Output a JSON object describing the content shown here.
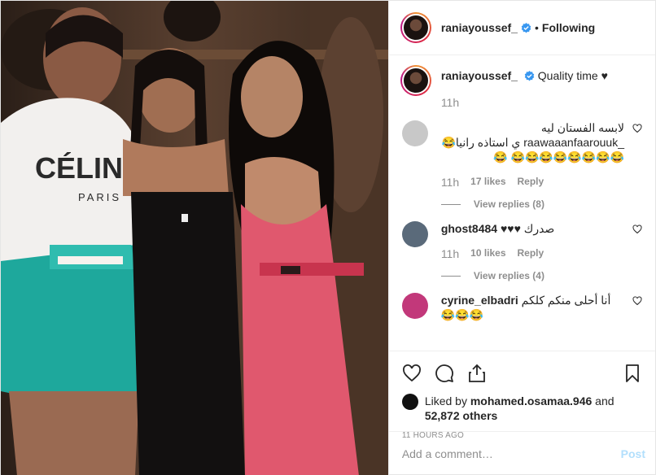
{
  "post": {
    "author": "raniayoussef_",
    "follow_state": "Following",
    "caption": "Quality time ♥",
    "caption_time": "11h",
    "photo_text": {
      "shirt_brand": "CÉLINE",
      "shirt_city": "PARIS"
    }
  },
  "comments": [
    {
      "user": "_raawaaanfaarouuk",
      "text": "لابسه الفستان ليه _raawaaanfaarouuk ي استاذه رانيا😂😂😂😂😂😂😂😂😂 😂",
      "time": "11h",
      "likes": "17 likes",
      "reply": "Reply",
      "view_replies": "View replies (8)",
      "avatar_color": "#c8c8c8"
    },
    {
      "user": "ghost8484",
      "text": "صدرك ♥♥♥",
      "time": "11h",
      "likes": "10 likes",
      "reply": "Reply",
      "view_replies": "View replies (4)",
      "avatar_color": "#5a6a7a"
    },
    {
      "user": "cyrine_elbadri",
      "text": "أنا أحلى منكم كلكم😂😂😂",
      "time": "",
      "likes": "",
      "reply": "",
      "view_replies": "",
      "avatar_color": "#c2387a"
    }
  ],
  "actions": {
    "like": "heart-icon",
    "comment": "comment-icon",
    "share": "share-icon",
    "save": "bookmark-icon"
  },
  "likes": {
    "liked_by_label": "Liked by",
    "liked_by_user": "mohamed.osamaa.946",
    "and": "and",
    "others": "52,872 others"
  },
  "timestamp": "11 HOURS AGO",
  "add_comment": {
    "placeholder": "Add a comment…",
    "post_label": "Post"
  },
  "colors": {
    "verified": "#3897f0",
    "link_disabled": "#b2dffc",
    "muted": "#8e8e8e"
  }
}
